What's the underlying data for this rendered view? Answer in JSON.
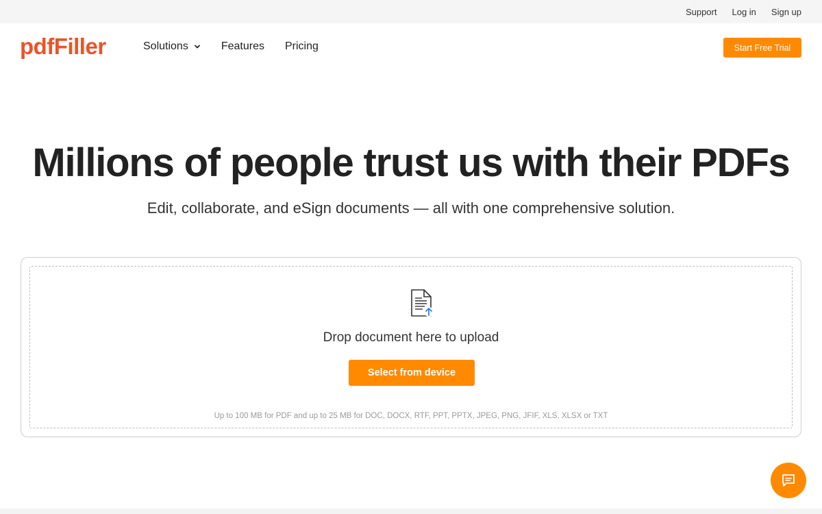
{
  "topbar": {
    "links": [
      "Support",
      "Log in",
      "Sign up"
    ]
  },
  "header": {
    "logo_text": "pdfFiller",
    "nav": [
      {
        "label": "Solutions",
        "has_dropdown": true
      },
      {
        "label": "Features",
        "has_dropdown": false
      },
      {
        "label": "Pricing",
        "has_dropdown": false
      }
    ],
    "cta_label": "Start Free Trial"
  },
  "hero": {
    "title": "Millions of people trust us with their PDFs",
    "subtitle": "Edit, collaborate, and eSign documents — all with one comprehensive solution."
  },
  "upload": {
    "icon": "document-upload-icon",
    "drop_text": "Drop document here to upload",
    "button_label": "Select from device",
    "limits_text": "Up to 100 MB for PDF and up to 25 MB for DOC, DOCX, RTF, PPT, PPTX, JPEG, PNG, JFIF, XLS, XLSX or TXT"
  },
  "chat": {
    "icon": "chat-icon"
  },
  "colors": {
    "brand": "#e8552b",
    "accent": "#ff8a00",
    "upload_arrow": "#1e88e5"
  }
}
